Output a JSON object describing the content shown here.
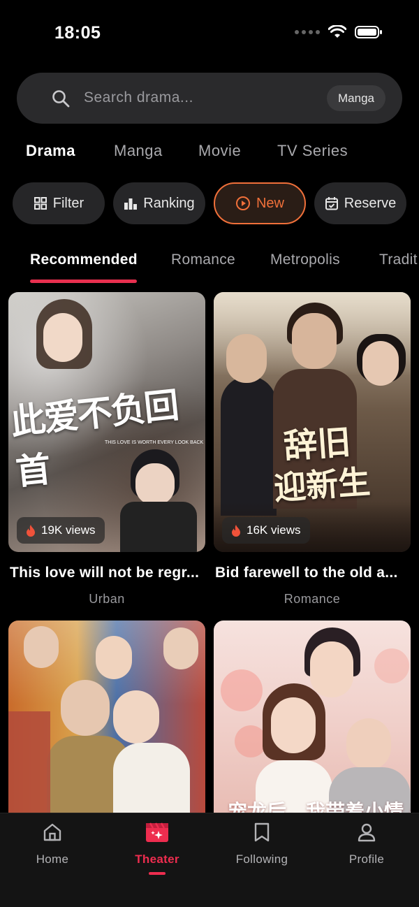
{
  "status": {
    "time": "18:05"
  },
  "search": {
    "placeholder": "Search drama...",
    "chip": "Manga"
  },
  "category_tabs": [
    "Drama",
    "Manga",
    "Movie",
    "TV Series"
  ],
  "filters": {
    "filter": "Filter",
    "ranking": "Ranking",
    "new": "New",
    "reserve": "Reserve"
  },
  "genre_tabs": [
    "Recommended",
    "Romance",
    "Metropolis",
    "Tradit"
  ],
  "cards": [
    {
      "title": "This love will not be regr...",
      "genre": "Urban",
      "views": "19K views",
      "poster_text": "此爱不负回首",
      "poster_sub": "THIS LOVE IS WORTH EVERY LOOK BACK"
    },
    {
      "title": "Bid farewell to the old a...",
      "genre": "Romance",
      "views": "16K views",
      "poster_text_1": "辞旧",
      "poster_text_2": "迎新生"
    },
    {
      "title": "",
      "genre": "",
      "views": ""
    },
    {
      "title": "",
      "genre": "",
      "views": "",
      "poster_text": "宠龙后，我带着小情人"
    }
  ],
  "nav": {
    "home": "Home",
    "theater": "Theater",
    "following": "Following",
    "profile": "Profile"
  },
  "colors": {
    "accent": "#ee2d4f",
    "new_orange": "#f0703a",
    "background": "#000000"
  }
}
